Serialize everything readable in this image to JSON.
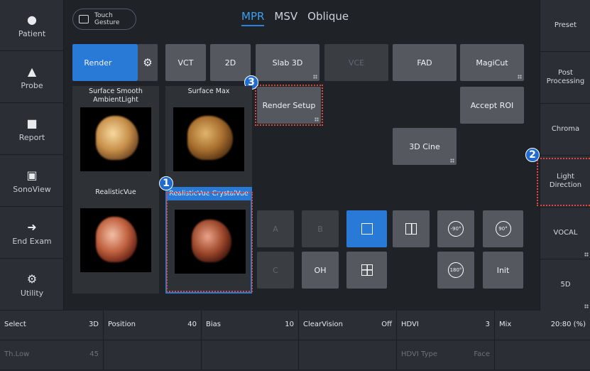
{
  "left_nav": [
    {
      "label": "Patient",
      "icon": "person-icon"
    },
    {
      "label": "Probe",
      "icon": "probe-icon"
    },
    {
      "label": "Report",
      "icon": "report-icon"
    },
    {
      "label": "SonoView",
      "icon": "sonoview-icon"
    },
    {
      "label": "End Exam",
      "icon": "exit-icon"
    },
    {
      "label": "Utility",
      "icon": "gear-icon"
    }
  ],
  "right_nav": [
    {
      "label": "Preset"
    },
    {
      "label": "Post Processing"
    },
    {
      "label": "Chroma"
    },
    {
      "label": "Light Direction"
    },
    {
      "label": "VOCAL"
    },
    {
      "label": "5D"
    }
  ],
  "touch_gesture": "Touch Gesture",
  "tabs": [
    "MPR",
    "MSV",
    "Oblique"
  ],
  "toolbar": {
    "render": "Render",
    "vct": "VCT",
    "two_d": "2D",
    "slab3d": "Slab 3D",
    "vce": "VCE",
    "fad": "FAD",
    "magicut": "MagiCut",
    "render_setup": "Render Setup",
    "accept_roi": "Accept ROI",
    "cine3d": "3D Cine",
    "a": "A",
    "b": "B",
    "c": "C",
    "oh": "OH",
    "init": "Init"
  },
  "thumbnails": [
    {
      "label": "Surface Smooth AmbientLight"
    },
    {
      "label": "Surface Max"
    },
    {
      "label": "RealisticVue"
    },
    {
      "label": "RealisticVue CrystalVue"
    }
  ],
  "rotate": {
    "left": "-90°",
    "right": "90°",
    "flip": "180°"
  },
  "badges": [
    "1",
    "2",
    "3"
  ],
  "status_row1": [
    {
      "k": "Select",
      "v": "3D"
    },
    {
      "k": "Position",
      "v": "40"
    },
    {
      "k": "Bias",
      "v": "10"
    },
    {
      "k": "ClearVision",
      "v": "Off"
    },
    {
      "k": "HDVI",
      "v": "3"
    },
    {
      "k": "Mix",
      "v": "20:80 (%)"
    }
  ],
  "status_row2": [
    {
      "k": "Th.Low",
      "v": "45"
    },
    {
      "k": "",
      "v": ""
    },
    {
      "k": "",
      "v": ""
    },
    {
      "k": "",
      "v": ""
    },
    {
      "k": "HDVI Type",
      "v": "Face"
    },
    {
      "k": "",
      "v": ""
    }
  ],
  "colors": {
    "accent": "#2979d6",
    "highlight": "#e0453f"
  }
}
